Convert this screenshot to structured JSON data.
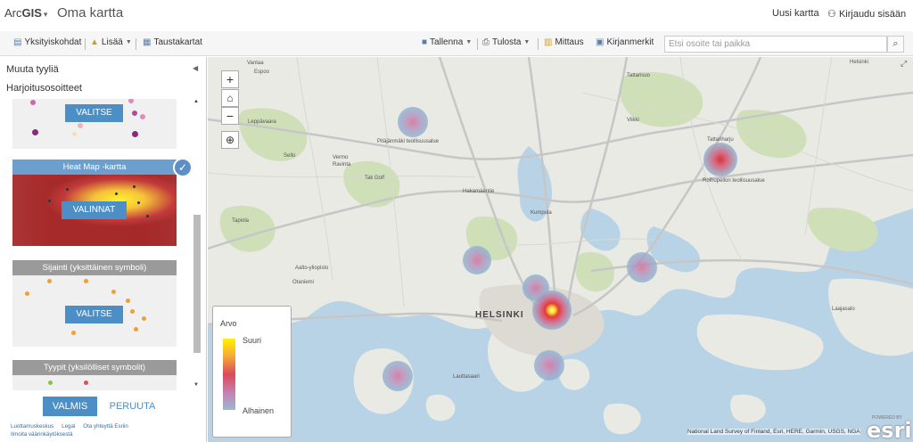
{
  "header": {
    "brand_prefix": "Arc",
    "brand_bold": "GIS",
    "title": "Oma kartta",
    "new_map": "Uusi kartta",
    "sign_in": "Kirjaudu sisään"
  },
  "toolbar": {
    "details": "Yksityiskohdat",
    "add": "Lisää",
    "basemaps": "Taustakartat",
    "save": "Tallenna",
    "print": "Tulosta",
    "measure": "Mittaus",
    "bookmarks": "Kirjanmerkit",
    "search_placeholder": "Etsi osoite tai paikka"
  },
  "sidebar": {
    "heading": "Muuta tyyliä",
    "layer_name": "Harjoitusosoitteet",
    "cards": [
      {
        "title": "",
        "button": "VALITSE"
      },
      {
        "title": "Heat Map -kartta",
        "button": "VALINNAT",
        "selected": true
      },
      {
        "title": "Sijainti (yksittäinen symboli)",
        "button": "VALITSE"
      },
      {
        "title": "Tyypit (yksilölliset symbolit)",
        "button": ""
      }
    ],
    "done": "VALMIS",
    "cancel": "PERUUTA",
    "footer_links": [
      "Luottamuskeskus",
      "Legal",
      "Ota yhteyttä Esriin",
      "Ilmoita väärinkäytöksestä"
    ]
  },
  "map": {
    "zoom_in": "+",
    "zoom_out": "−",
    "home_icon": "home-icon",
    "locate_icon": "locate-icon",
    "city_label": "HELSINKI",
    "places": [
      "Vantaa",
      "Espoo",
      "Leppävaara",
      "Sello",
      "Vermo",
      "Ravinta",
      "Tak Golf",
      "Tapiola",
      "Otaniemi",
      "Aalto-yliopisto",
      "Pitäjänmäki teollisuusalue",
      "Hakamäentie",
      "Kumpula",
      "Tattarisuo",
      "Viikki",
      "Roihupellon teollisuusalue",
      "Tattariharju",
      "Lauttasaari",
      "Helsinki",
      "Laajasalo"
    ],
    "legend": {
      "title": "Arvo",
      "high": "Suuri",
      "low": "Alhainen"
    },
    "attribution": "National Land Survey of Finland, Esri, HERE, Garmin, USGS, NGA",
    "esri_powered": "POWERED BY",
    "esri_logo": "esri"
  }
}
